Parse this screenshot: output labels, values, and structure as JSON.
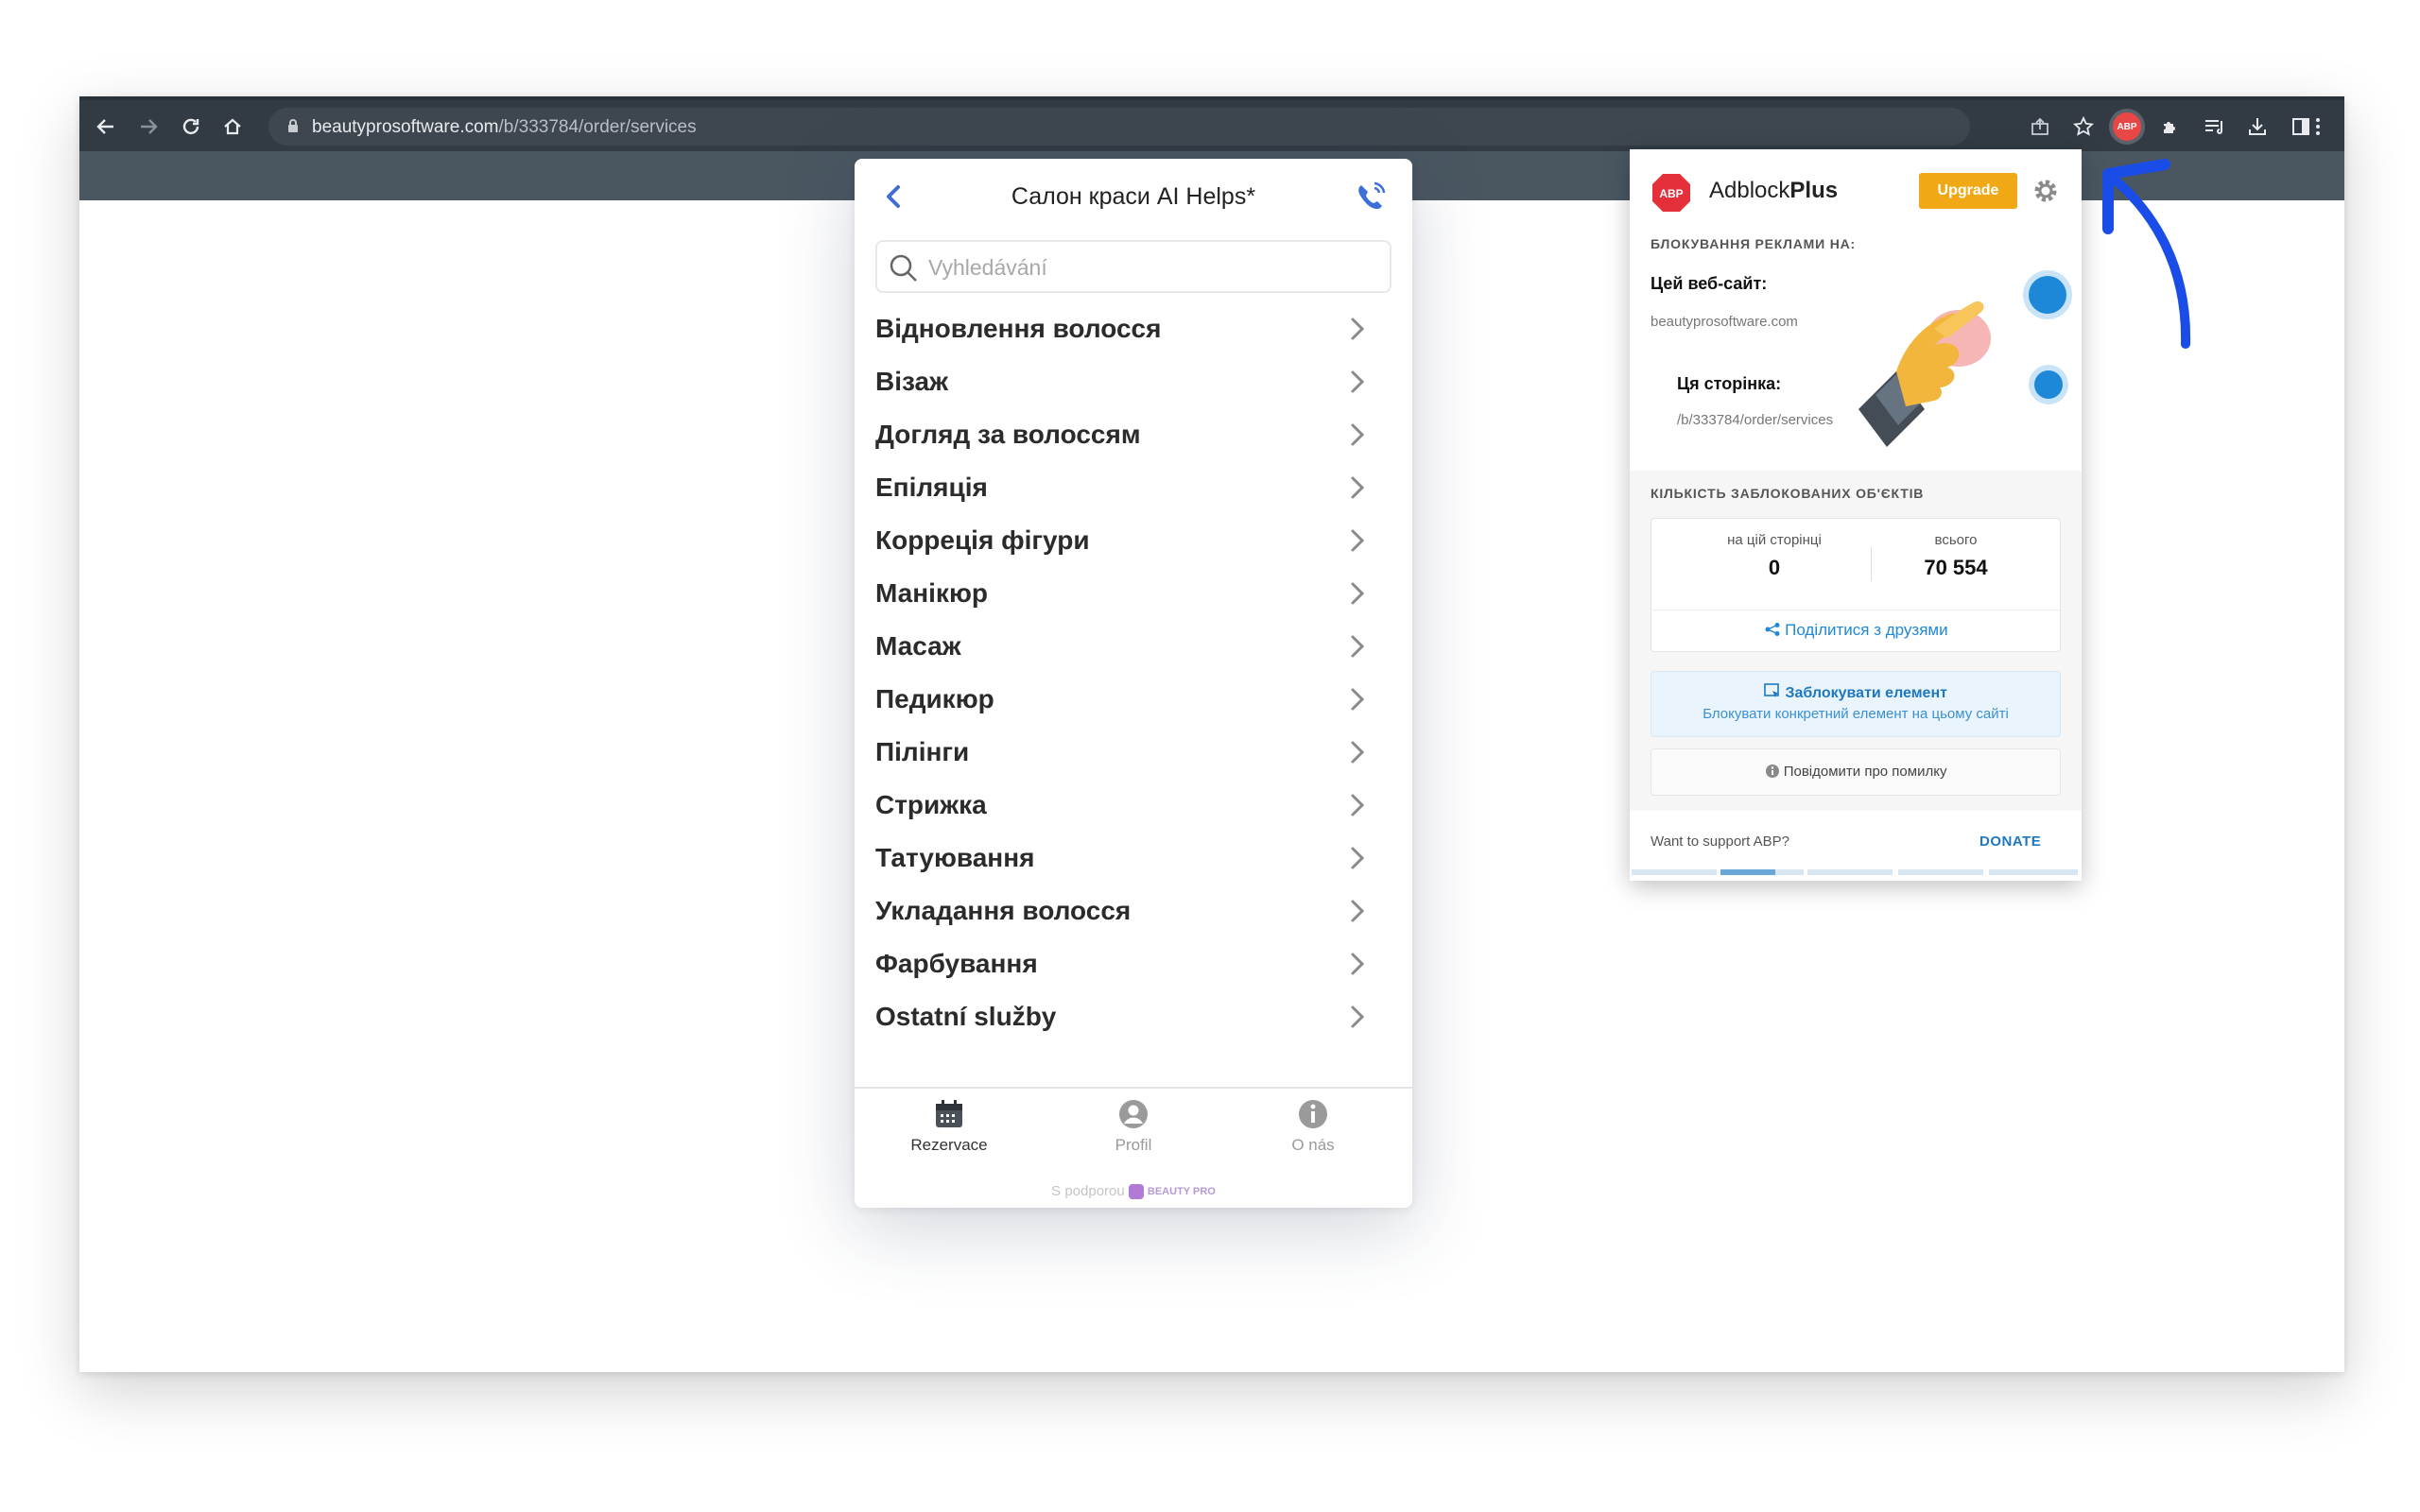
{
  "browser": {
    "url_host": "beautyprosoftware.com",
    "url_path": "/b/333784/order/services"
  },
  "widget": {
    "title": "Салон краси AI Helps*",
    "search_placeholder": "Vyhledávání",
    "categories": [
      "Відновлення волосся",
      "Візаж",
      "Догляд за волоссям",
      "Епіляція",
      "Корреція фігури",
      "Манікюр",
      "Масаж",
      "Педикюр",
      "Пілінги",
      "Стрижка",
      "Татуювання",
      "Укладання волосся",
      "Фарбування",
      "Ostatní služby"
    ],
    "nav": {
      "reservations": "Rezervace",
      "profile": "Profil",
      "about": "O nás"
    },
    "powered_by": "S podporou",
    "powered_brand": "BEAUTY PRO"
  },
  "abp": {
    "brand_prefix": "Adblock",
    "brand_suffix": "Plus",
    "logo_text": "ABP",
    "upgrade": "Upgrade",
    "blocking_on": "БЛОКУВАННЯ РЕКЛАМИ НА:",
    "this_site": "Цей веб-сайт:",
    "site_domain": "beautyprosoftware.com",
    "this_page": "Ця сторінка:",
    "page_path": "/b/333784/order/services",
    "blocked_count_label": "КІЛЬКІСТЬ ЗАБЛОКОВАНИХ ОБ'ЄКТІВ",
    "on_page_label": "на цій сторінці",
    "on_page_value": "0",
    "total_label": "всього",
    "total_value": "70 554",
    "share": "Поділитися з друзями",
    "block_element_title": "Заблокувати елемент",
    "block_element_sub": "Блокувати конкретний елемент на цьому сайті",
    "report": "Повідомити про помилку",
    "support_q": "Want to support ABP?",
    "donate": "DONATE"
  },
  "colors": {
    "toolbar": "#323b43",
    "accent_blue": "#1e88d8",
    "abp_red": "#e94646",
    "upgrade_orange": "#f0a814"
  }
}
